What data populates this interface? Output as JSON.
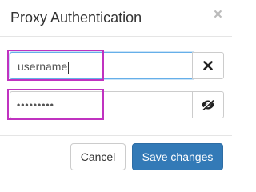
{
  "dialog": {
    "title": "Proxy Authentication",
    "close_label": "×"
  },
  "username": {
    "value": "username"
  },
  "password": {
    "value": "•••••••••"
  },
  "icons": {
    "clear": "close-icon",
    "reveal": "eye-slash-icon"
  },
  "footer": {
    "cancel_label": "Cancel",
    "save_label": "Save changes"
  },
  "colors": {
    "primary": "#337ab7",
    "highlight": "#c032c0",
    "focus": "#66afe9"
  }
}
